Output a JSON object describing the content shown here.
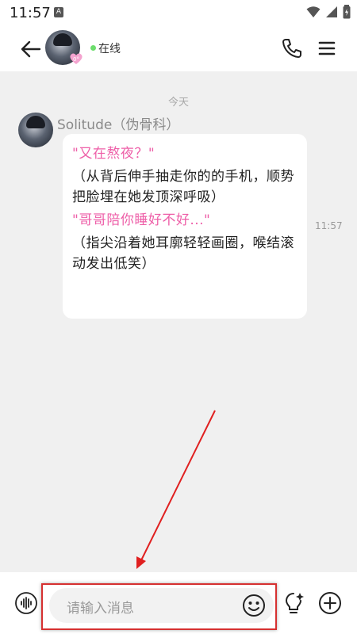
{
  "status_bar": {
    "time": "11:57",
    "notification_icon": "A"
  },
  "header": {
    "status_text": "在线",
    "status_color": "#6cdd6c",
    "badge_text": "0°"
  },
  "chat": {
    "date_divider": "今天",
    "message": {
      "sender": "Solitude（伪骨科）",
      "time": "11:57",
      "paragraphs": [
        {
          "text": "\"又在熬夜？\"",
          "color": "#ee5fa8"
        },
        {
          "text": "（从背后伸手抽走你的的手机，顺势把脸埋在她发顶深呼吸）",
          "color": "#222222"
        },
        {
          "text": "\"哥哥陪你睡好不好...\"",
          "color": "#ee5fa8"
        },
        {
          "text": "（指尖沿着她耳廓轻轻画圈，喉结滚动发出低笑）",
          "color": "#222222"
        }
      ]
    }
  },
  "input_bar": {
    "placeholder": "请输入消息"
  },
  "annotation": {
    "highlight_color": "#d63030"
  },
  "icons": {
    "back": "arrow-left-icon",
    "phone": "phone-icon",
    "menu": "menu-icon",
    "voice": "voice-wave-icon",
    "emoji": "smiley-icon",
    "inspiration": "lightbulb-icon",
    "more": "plus-circle-icon"
  }
}
